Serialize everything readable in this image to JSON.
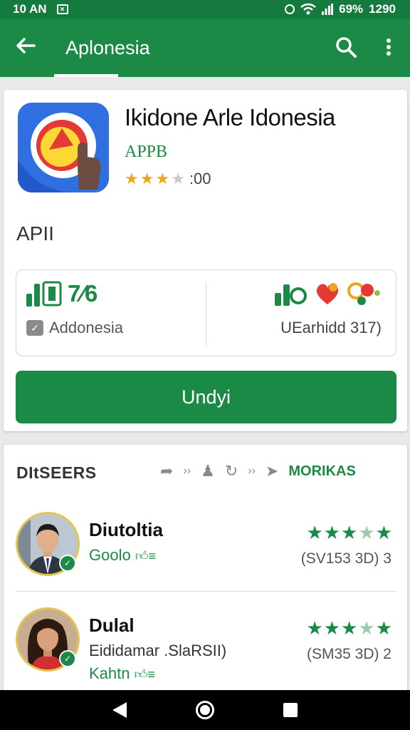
{
  "status_bar": {
    "time": "10 AN",
    "battery": "69%",
    "clock": "1290"
  },
  "app_bar": {
    "title": "Aplonesia"
  },
  "app": {
    "name": "Ikidone Arle Idonesia",
    "developer": "APPB",
    "rating_stars": 3.5,
    "rating_count": ":00"
  },
  "section_label": "APII",
  "stats": {
    "left_value": "7⁄6",
    "left_label": "Addonesia",
    "right_label": "UEarhidd 317)"
  },
  "install_button": "Undyi",
  "reviews": {
    "header": "DItSEERS",
    "more_label": "MORIKAS",
    "items": [
      {
        "name": "Diutoltia",
        "line1": "Goolo",
        "line2": "",
        "meta": "(SV153 3D) 3",
        "stars": 4.5
      },
      {
        "name": "Dulal",
        "line1": "Eididamar .SlaRSII)",
        "line2": "Kahtn",
        "meta": "(SM35 3D) 2",
        "stars": 4.5
      }
    ]
  },
  "colors": {
    "primary": "#1b8a46",
    "status_bar": "#157a3d",
    "star": "#f2a51a"
  }
}
